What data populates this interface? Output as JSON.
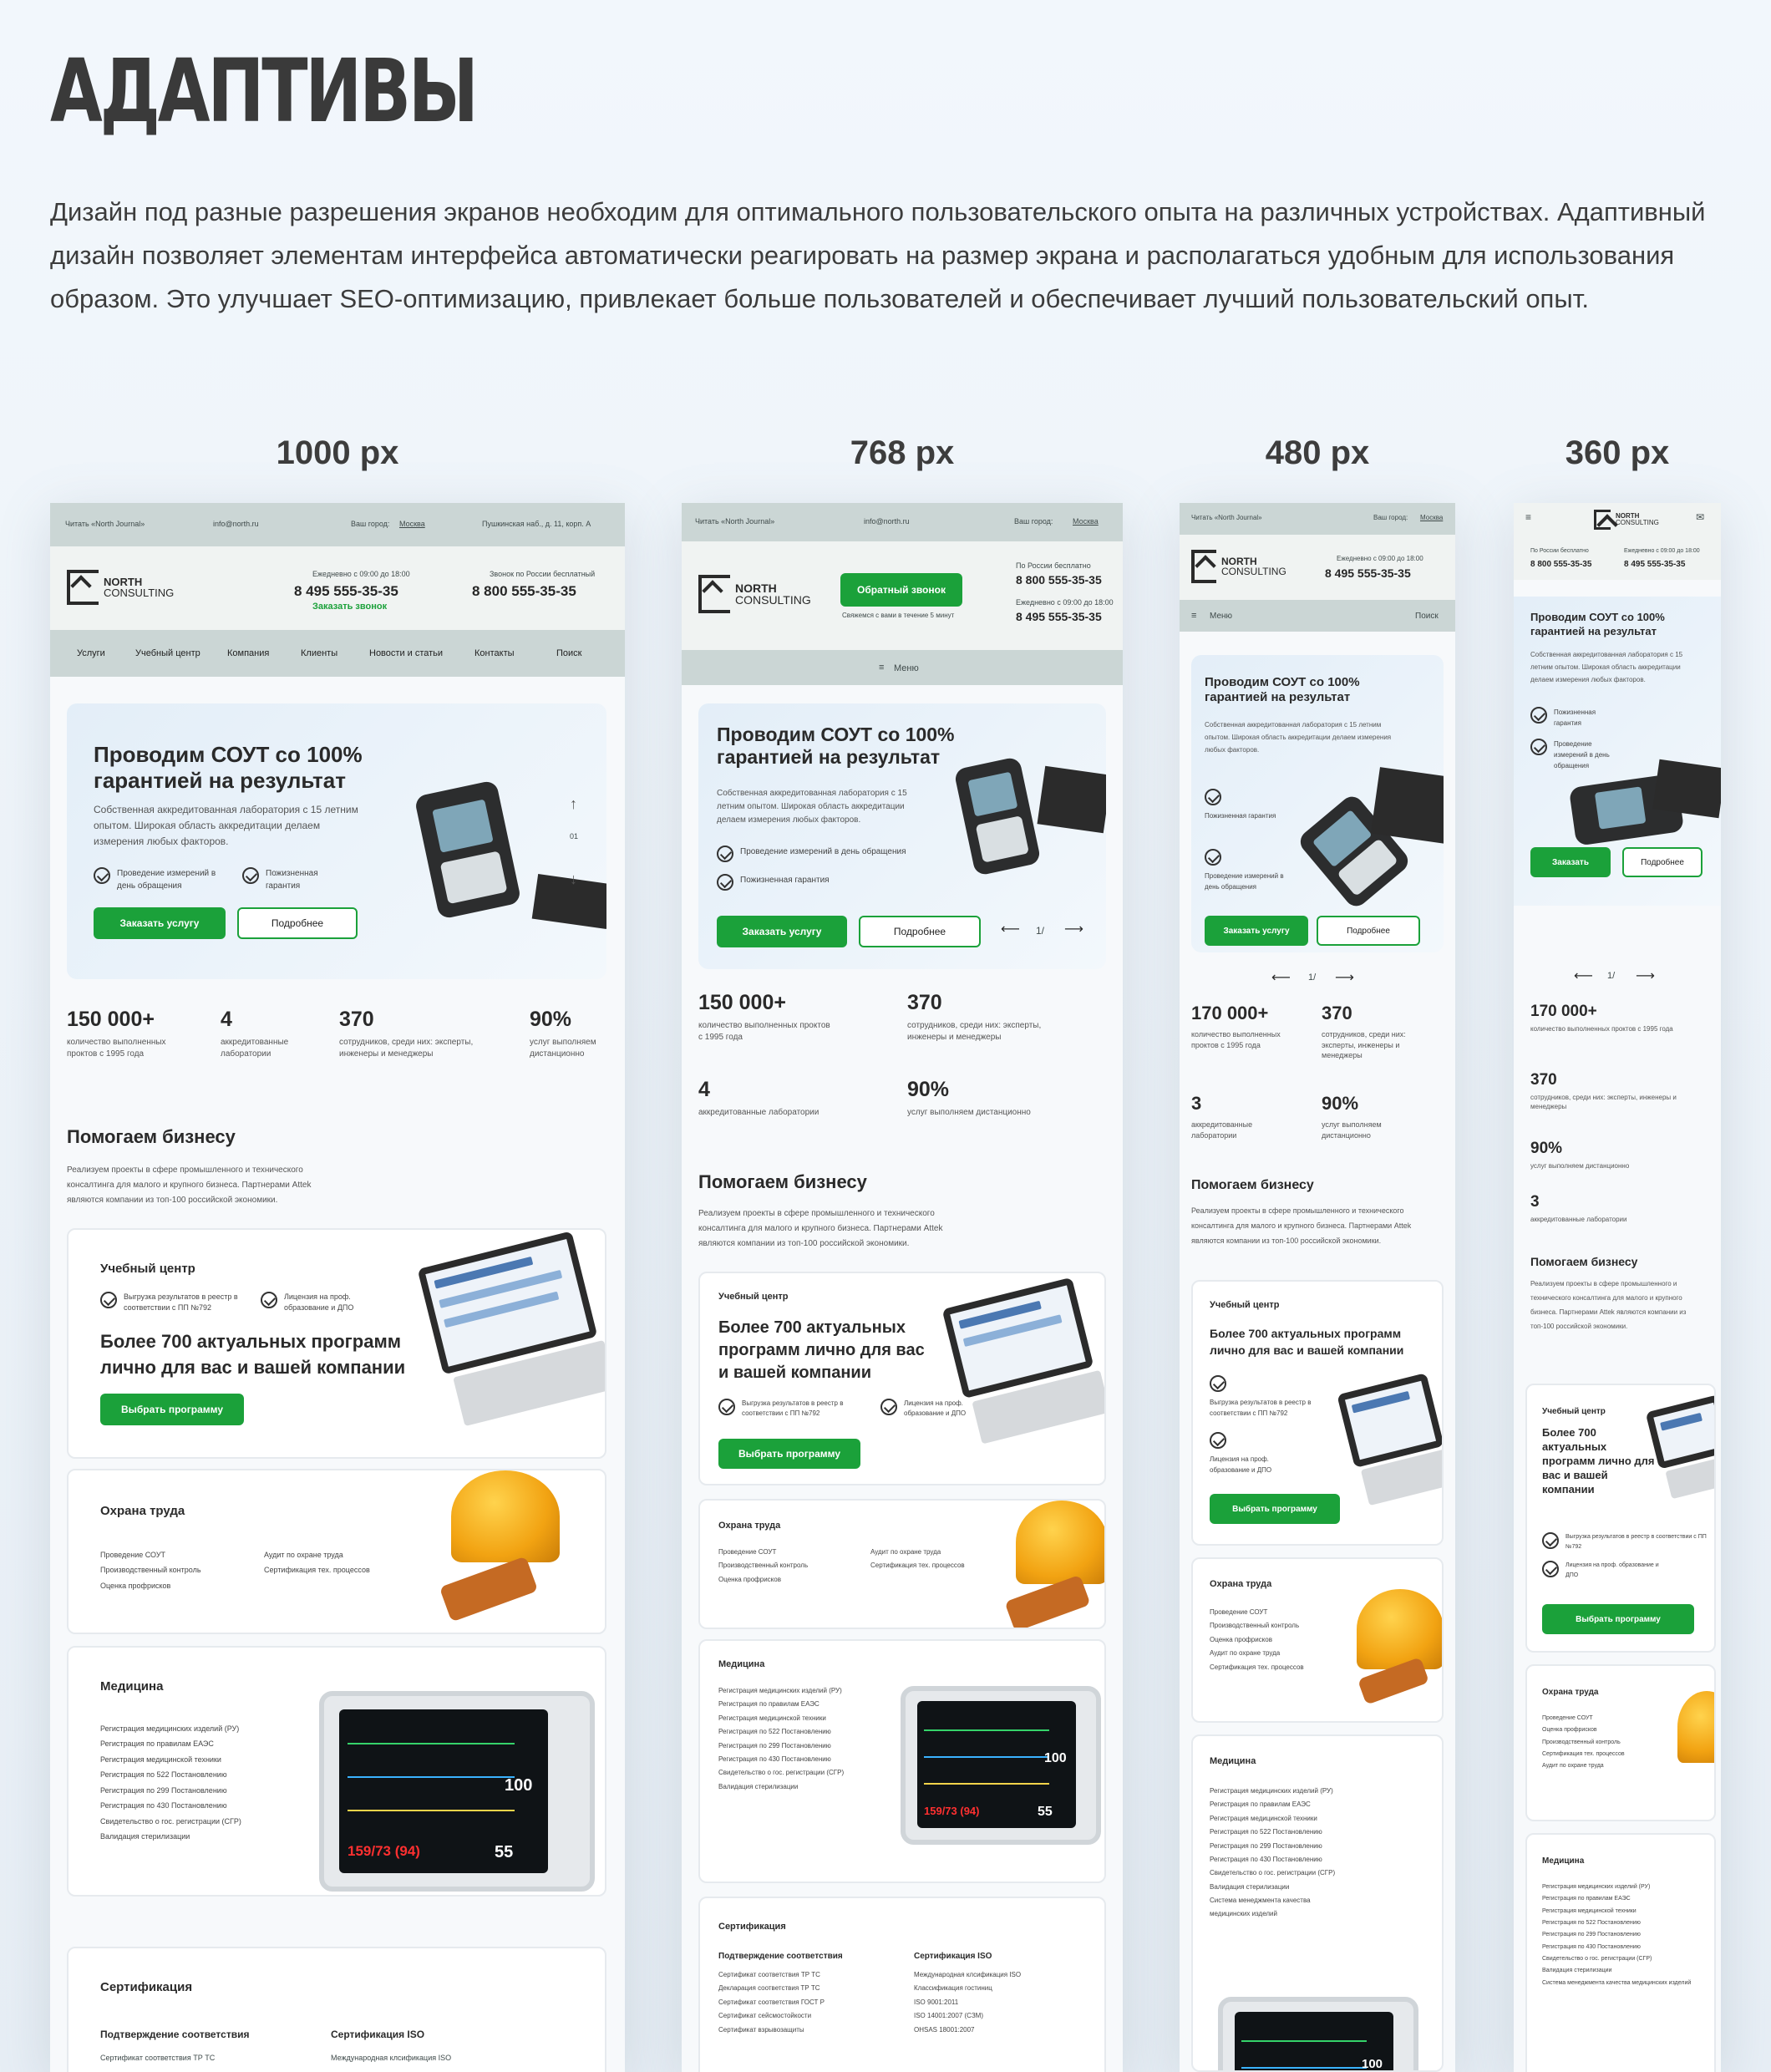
{
  "page": {
    "title": "АДАПТИВЫ",
    "intro": "Дизайн под разные разрешения экранов необходим для оптимального пользовательского опыта на различных устройствах. Адаптивный дизайн позволяет элементам интерфейса автоматически реагировать на размер экрана и располагаться удобным для использования образом. Это улучшает SEO-оптимизацию, привлекает больше пользователей и обеспечивает лучший пользовательский опыт."
  },
  "breakpoints": [
    "1000 px",
    "768 px",
    "480 px",
    "360 px"
  ],
  "common": {
    "journal": "Читать «North Journal»",
    "email": "info@north.ru",
    "city_label": "Ваш город:",
    "city": "Москва",
    "address": "Пушкинская наб., д. 11, корп. А",
    "phone_local_note": "Ежедневно с 09:00 до 18:00",
    "phone_local": "8 495 555-35-35",
    "phone_free_note": "Звонок по России бесплатный",
    "phone_free_note_short": "По России бесплатно",
    "phone_free": "8 800 555-35-35",
    "callback_link": "Заказать звонок",
    "callback_button": "Обратный звонок",
    "callback_sub": "Свяжемся с вами в течение 5 минут",
    "logo_top": "NORTH",
    "logo_bottom": "CONSULTING",
    "menu": "Меню",
    "search": "Поиск",
    "nav": [
      "Услуги",
      "Учебный центр",
      "Компания",
      "Клиенты",
      "Новости и статьи",
      "Контакты",
      "Поиск"
    ],
    "hero_title": "Проводим СОУТ со 100% гарантией на результат",
    "hero_text": "Собственная аккредитованная лаборатория с 15 летним опытом. Широкая область аккредитации делаем измерения любых факторов.",
    "hero_check1": "Проведение измерений в день обращения",
    "hero_check2": "Пожизненная гарантия",
    "order": "Заказать услугу",
    "order_short": "Заказать",
    "more": "Подробнее",
    "slider_index": "1/",
    "slide_num": "01",
    "help_title": "Помогаем бизнесу",
    "help_text": "Реализуем проекты в сфере промышленного и технического консалтинга для малого и крупного бизнеса. Партнерами Attek являются компании из топ-100 российской экономики.",
    "edu_title": "Учебный центр",
    "edu_head": "Более 700 актуальных программ лично для вас и вашей компании",
    "edu_check1": "Выгрузка результатов в реестр в соответствии с ПП №792",
    "edu_check2": "Лицензия на проф. образование и ДПО",
    "edu_btn": "Выбрать программу",
    "safety_title": "Охрана труда",
    "safety_items": [
      "Проведение СОУТ",
      "Производственный контроль",
      "Оценка профрисков",
      "Аудит по охране труда",
      "Сертификация тех. процессов"
    ],
    "med_title": "Медицина",
    "med_items": [
      "Регистрация медицинских изделий (РУ)",
      "Регистрация по правилам ЕАЭС",
      "Регистрация медицинской техники",
      "Регистрация по 522 Постановлению",
      "Регистрация по 299 Постановлению",
      "Регистрация по 430 Постановлению",
      "Свидетельство о гос. регистрации (СГР)",
      "Валидация стерилизации",
      "Система менеджмента качества медицинских изделий"
    ],
    "cert_title": "Сертификация",
    "cert_col1": "Подтверждение соответствия",
    "cert_col2": "Сертификация ISO",
    "cert_items1": [
      "Сертификат соответствия ТР ТС",
      "Декларация соответствия ТР ТС",
      "Сертификат соответствия ГОСТ Р",
      "Сертификат сейсмостойкости",
      "Сертификат взрывозащиты"
    ],
    "cert_items2": [
      "Международная клсификация ISO",
      "Классификация гостиниц",
      "ISO 9001:2011",
      "ISO 14001:2007 (СЗМ)",
      "OHSAS 18001:2007"
    ],
    "monitor_v1": "100",
    "monitor_v2": "55",
    "monitor_v3": "159/73 (94)"
  },
  "stats": {
    "s1": {
      "value": "150 000+",
      "value_alt": "170 000+",
      "label": "количество выполненных проктов с 1995 года"
    },
    "s2": {
      "value": "4",
      "value_alt": "3",
      "label": "аккредитованные лаборатории"
    },
    "s3": {
      "value": "370",
      "label": "сотрудников, среди них: эксперты, инженеры и менеджеры"
    },
    "s4": {
      "value": "90%",
      "label": "услуг выполняем дистанционно"
    }
  },
  "colors": {
    "accent": "#1ba13a",
    "topbar": "#cbd6d5",
    "header": "#f0f3f2"
  }
}
